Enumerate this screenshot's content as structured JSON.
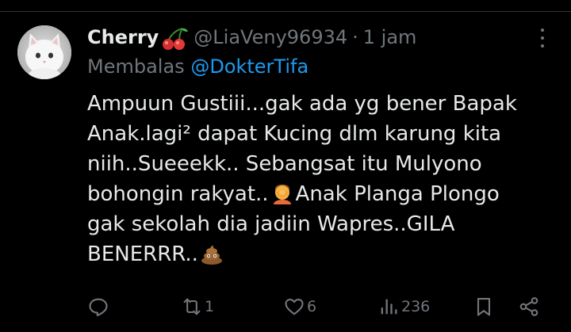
{
  "tweet": {
    "display_name": "Cherry",
    "name_emoji": "cherries",
    "handle": "@LiaVeny96934",
    "separator": "·",
    "time": "1 jam",
    "reply_prefix": "Membalas",
    "reply_to": "@DokterTifa",
    "lines": [
      "Ampuun Gustiii...gak ada yg bener Bapak",
      "Anak.lagi² dapat Kucing dlm karung kita",
      "niih..Sueeekk.. Sebangsat itu Mulyono",
      "bohongin rakyat..",
      "Anak Planga Plongo",
      "gak sekolah dia jadiin Wapres..GILA",
      "BENERRR.."
    ],
    "inline_emojis": [
      "person-facepalming",
      "pile-of-poo"
    ]
  },
  "actions": {
    "reply_icon": "comment-icon",
    "retweet_icon": "retweet-icon",
    "retweet_count": "1",
    "like_icon": "heart-icon",
    "like_count": "6",
    "views_icon": "bar-chart-icon",
    "views_count": "236",
    "bookmark_icon": "bookmark-icon",
    "share_icon": "share-icon"
  },
  "colors": {
    "background": "#000000",
    "text": "#e7e9ea",
    "muted": "#71767b",
    "link": "#1d9bf0"
  }
}
